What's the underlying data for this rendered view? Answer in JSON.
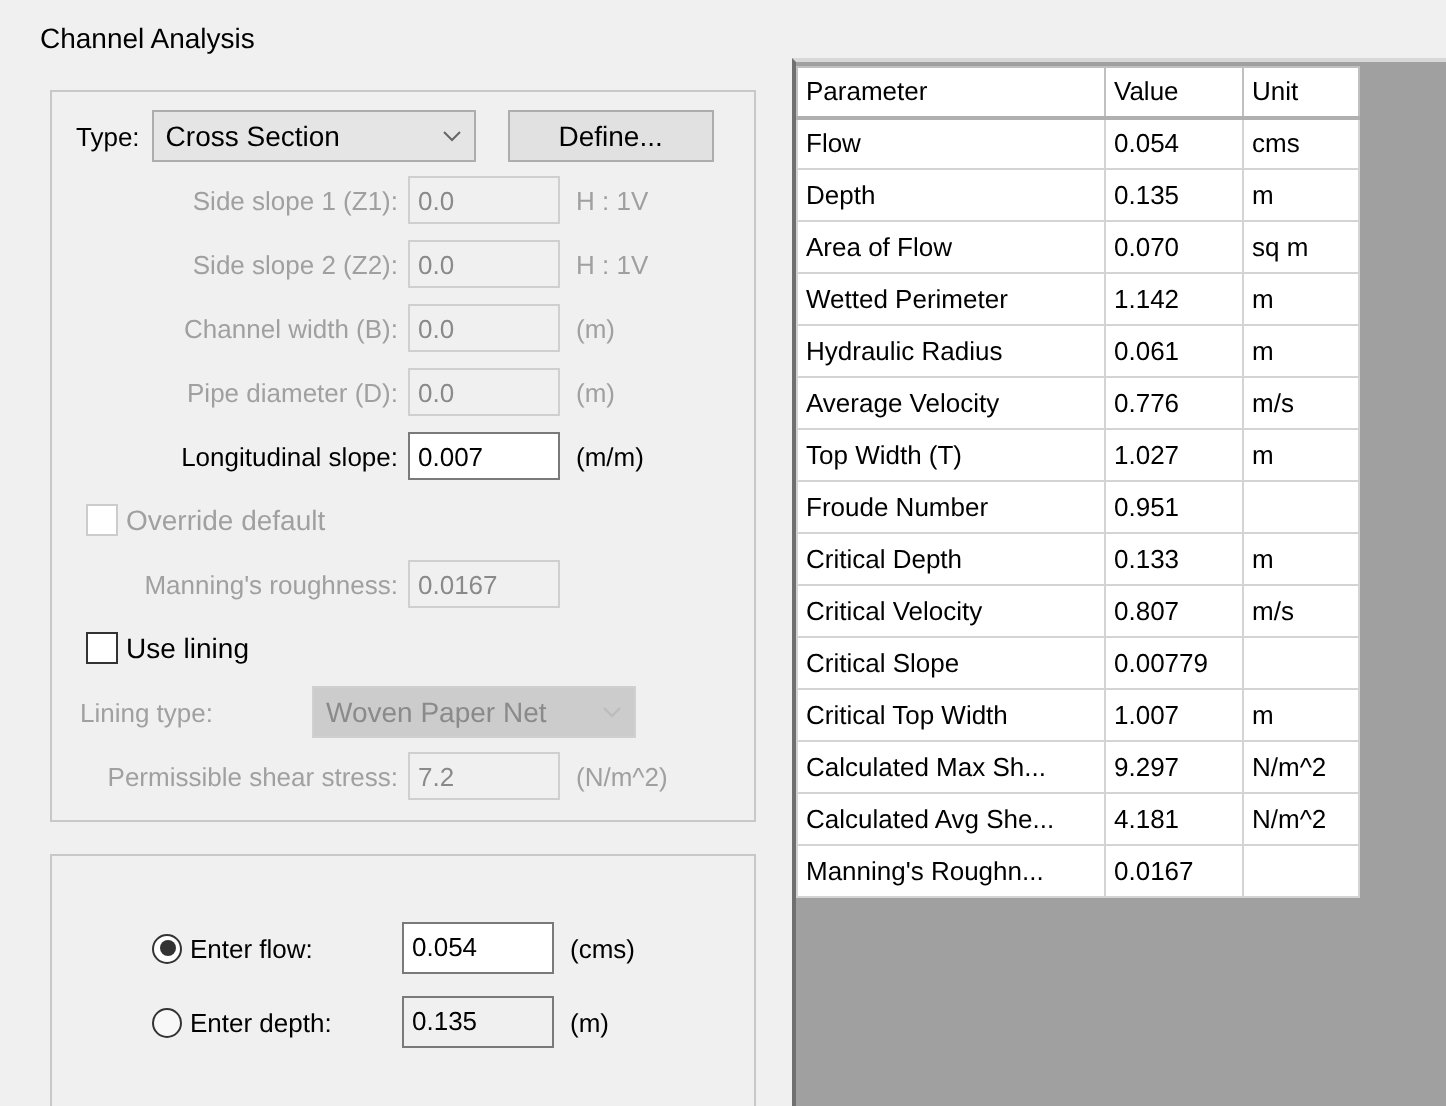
{
  "window": {
    "title": "Channel Analysis"
  },
  "type_row": {
    "label": "Type:",
    "value": "Cross Section",
    "button": "Define..."
  },
  "fields": [
    {
      "label": "Side slope 1 (Z1):",
      "value": "0.0",
      "unit": "H : 1V",
      "disabled": true
    },
    {
      "label": "Side slope 2 (Z2):",
      "value": "0.0",
      "unit": "H : 1V",
      "disabled": true
    },
    {
      "label": "Channel width (B):",
      "value": "0.0",
      "unit": "(m)",
      "disabled": true
    },
    {
      "label": "Pipe diameter (D):",
      "value": "0.0",
      "unit": "(m)",
      "disabled": true
    },
    {
      "label": "Longitudinal slope:",
      "value": "0.007",
      "unit": "(m/m)",
      "disabled": false
    }
  ],
  "override": {
    "label": "Override default",
    "checked": false,
    "disabled": true
  },
  "manning": {
    "label": "Manning's roughness:",
    "value": "0.0167",
    "disabled": true
  },
  "use_lining": {
    "label": "Use lining",
    "checked": false,
    "disabled": false
  },
  "lining_type": {
    "label": "Lining type:",
    "value": "Woven Paper Net",
    "disabled": true
  },
  "shear": {
    "label": "Permissible shear stress:",
    "value": "7.2",
    "unit": "(N/m^2)",
    "disabled": true
  },
  "inputs": [
    {
      "label": "Enter flow:",
      "value": "0.054",
      "unit": "(cms)",
      "selected": true
    },
    {
      "label": "Enter depth:",
      "value": "0.135",
      "unit": "(m)",
      "selected": false
    }
  ],
  "table": {
    "columns": [
      "Parameter",
      "Value",
      "Unit"
    ],
    "rows": [
      [
        "Flow",
        "0.054",
        "cms"
      ],
      [
        "Depth",
        "0.135",
        "m"
      ],
      [
        "Area of Flow",
        "0.070",
        "sq m"
      ],
      [
        "Wetted Perimeter",
        "1.142",
        "m"
      ],
      [
        "Hydraulic Radius",
        "0.061",
        "m"
      ],
      [
        "Average Velocity",
        "0.776",
        "m/s"
      ],
      [
        "Top Width (T)",
        "1.027",
        "m"
      ],
      [
        "Froude Number",
        "0.951",
        ""
      ],
      [
        "Critical Depth",
        "0.133",
        "m"
      ],
      [
        "Critical Velocity",
        "0.807",
        "m/s"
      ],
      [
        "Critical Slope",
        "0.00779",
        ""
      ],
      [
        "Critical Top Width",
        "1.007",
        "m"
      ],
      [
        "Calculated Max Sh...",
        "9.297",
        "N/m^2"
      ],
      [
        "Calculated Avg She...",
        "4.181",
        "N/m^2"
      ],
      [
        "Manning's Roughn...",
        "0.0167",
        ""
      ]
    ]
  }
}
